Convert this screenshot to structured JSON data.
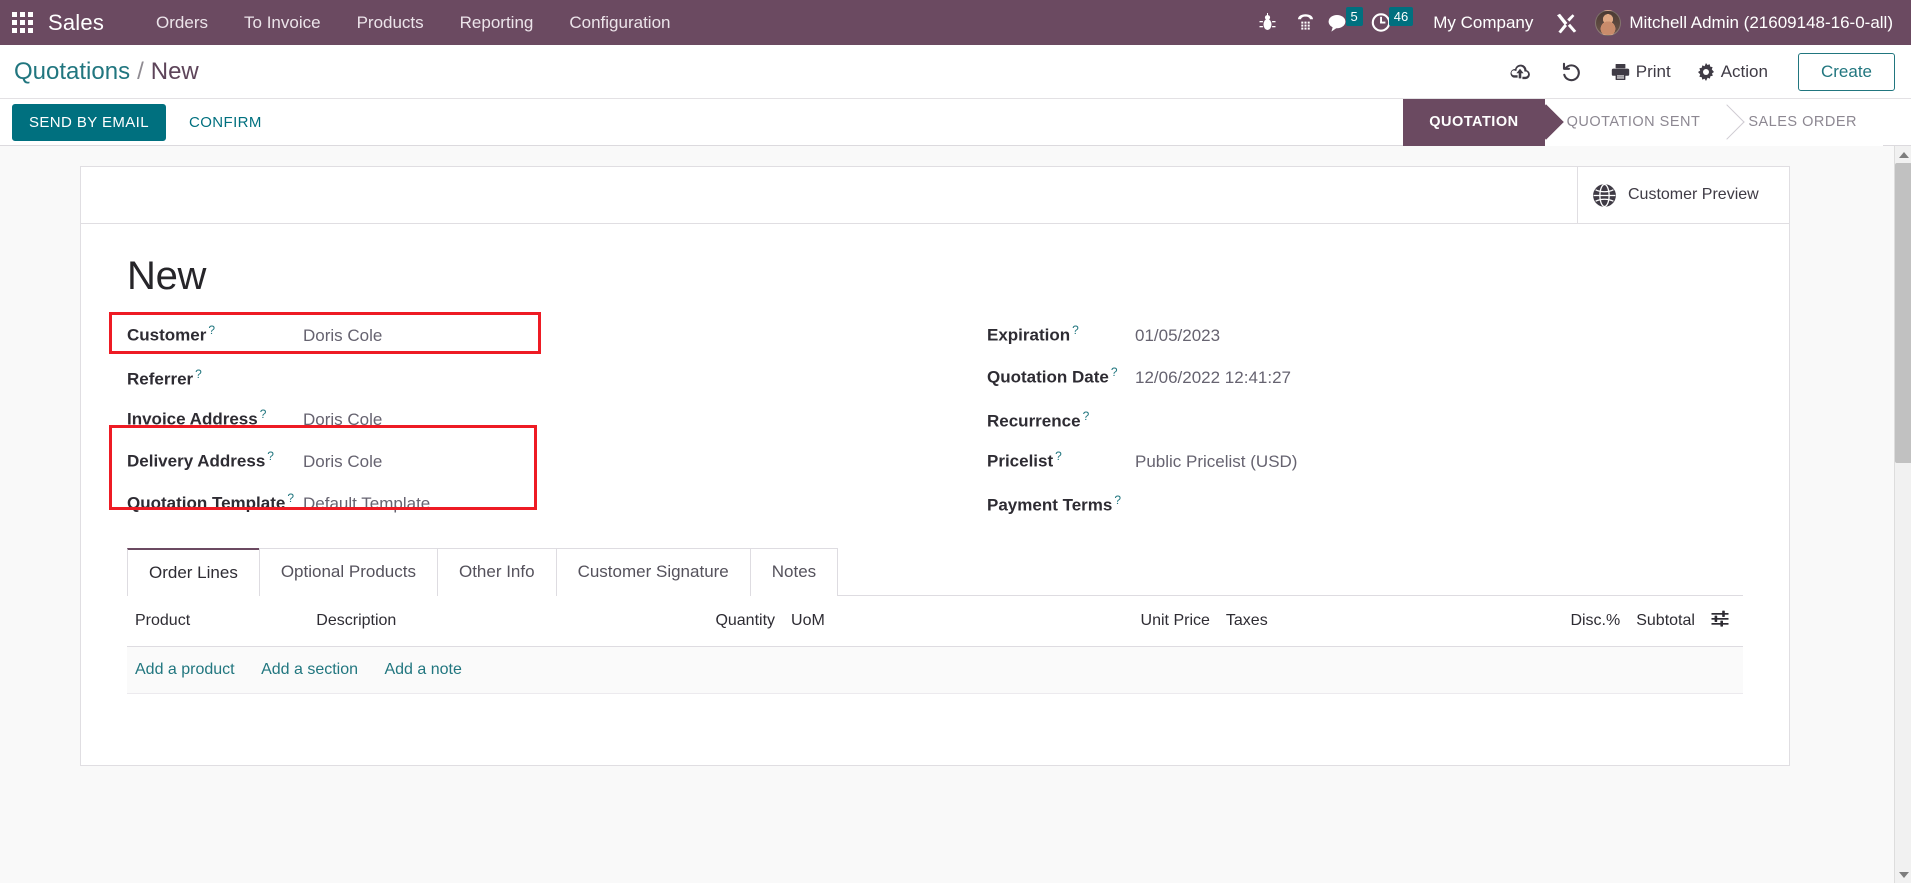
{
  "navbar": {
    "brand": "Sales",
    "apps_icon": "apps-grid-icon",
    "menu": [
      {
        "label": "Orders"
      },
      {
        "label": "To Invoice"
      },
      {
        "label": "Products"
      },
      {
        "label": "Reporting"
      },
      {
        "label": "Configuration"
      }
    ],
    "icons": [
      {
        "name": "bug-icon",
        "glyph": "\u0001"
      },
      {
        "name": "phone-dialpad-icon",
        "glyph": "\u0001"
      }
    ],
    "messages_count": "5",
    "activities_count": "46",
    "company": "My Company",
    "tools_icon": "tools-icon",
    "user": "Mitchell Admin (21609148-16-0-all)",
    "accent": "#6b4a61",
    "badge_color": "#00707f"
  },
  "breadcrumb": {
    "root": "Quotations",
    "separator": "/",
    "current": "New"
  },
  "control_panel": {
    "save_icon": "cloud-upload-icon",
    "discard_icon": "undo-icon",
    "print_label": "Print",
    "action_label": "Action",
    "create_label": "Create"
  },
  "status_bar": {
    "send_by_email": "SEND BY EMAIL",
    "confirm": "CONFIRM",
    "steps": [
      {
        "label": "QUOTATION",
        "active": true
      },
      {
        "label": "QUOTATION SENT",
        "active": false
      },
      {
        "label": "SALES ORDER",
        "active": false
      }
    ]
  },
  "sheet": {
    "customer_preview": "Customer Preview",
    "record_title": "New",
    "left_fields": [
      {
        "label": "Customer",
        "value": "Doris Cole",
        "help": "?"
      },
      {
        "label": "Referrer",
        "value": "",
        "help": "?"
      },
      {
        "label": "Invoice Address",
        "value": "Doris Cole",
        "help": "?"
      },
      {
        "label": "Delivery Address",
        "value": "Doris Cole",
        "help": "?"
      },
      {
        "label": "Quotation Template",
        "value": "Default Template",
        "help": "?"
      }
    ],
    "right_fields": [
      {
        "label": "Expiration",
        "value": "01/05/2023",
        "help": "?"
      },
      {
        "label": "Quotation Date",
        "value": "12/06/2022 12:41:27",
        "help": "?"
      },
      {
        "label": "Recurrence",
        "value": "",
        "help": "?"
      },
      {
        "label": "Pricelist",
        "value": "Public Pricelist (USD)",
        "help": "?"
      },
      {
        "label": "Payment Terms",
        "value": "",
        "help": "?"
      }
    ],
    "annotation_color": "#ee1b24"
  },
  "notebook": {
    "tabs": [
      {
        "label": "Order Lines",
        "active": true
      },
      {
        "label": "Optional Products",
        "active": false
      },
      {
        "label": "Other Info",
        "active": false
      },
      {
        "label": "Customer Signature",
        "active": false
      },
      {
        "label": "Notes",
        "active": false
      }
    ],
    "columns": [
      "Product",
      "Description",
      "Quantity",
      "UoM",
      "Unit Price",
      "Taxes",
      "Disc.%",
      "Subtotal"
    ],
    "optional_columns_icon": "sliders-icon",
    "add_links": [
      {
        "label": "Add a product"
      },
      {
        "label": "Add a section"
      },
      {
        "label": "Add a note"
      }
    ]
  }
}
